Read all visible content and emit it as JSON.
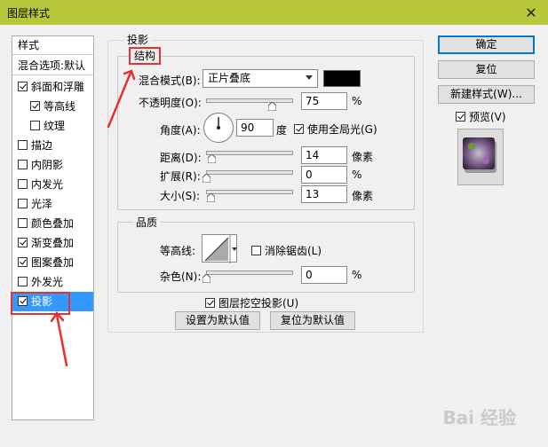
{
  "window": {
    "title": "图层样式",
    "close_glyph": "✕"
  },
  "style_list": {
    "header": "样式",
    "blend_options": "混合选项:默认",
    "items": [
      {
        "label": "斜面和浮雕",
        "checked": true,
        "indent": false
      },
      {
        "label": "等高线",
        "checked": true,
        "indent": true
      },
      {
        "label": "纹理",
        "checked": false,
        "indent": true
      },
      {
        "label": "描边",
        "checked": false,
        "indent": false
      },
      {
        "label": "内阴影",
        "checked": false,
        "indent": false
      },
      {
        "label": "内发光",
        "checked": false,
        "indent": false
      },
      {
        "label": "光泽",
        "checked": false,
        "indent": false
      },
      {
        "label": "颜色叠加",
        "checked": false,
        "indent": false
      },
      {
        "label": "渐变叠加",
        "checked": true,
        "indent": false
      },
      {
        "label": "图案叠加",
        "checked": true,
        "indent": false
      },
      {
        "label": "外发光",
        "checked": false,
        "indent": false
      },
      {
        "label": "投影",
        "checked": true,
        "indent": false,
        "selected": true
      }
    ]
  },
  "panel": {
    "title": "投影",
    "structure": {
      "title": "结构",
      "blend_mode_label": "混合模式(B):",
      "blend_mode_value": "正片叠底",
      "opacity_label": "不透明度(O):",
      "opacity_value": "75",
      "opacity_unit": "%",
      "opacity_fraction": 0.75,
      "angle_label": "角度(A):",
      "angle_value": "90",
      "angle_unit": "度",
      "global_light_label": "使用全局光(G)",
      "global_light_checked": true,
      "distance_label": "距离(D):",
      "distance_value": "14",
      "distance_unit": "像素",
      "distance_fraction": 0.06,
      "spread_label": "扩展(R):",
      "spread_value": "0",
      "spread_unit": "%",
      "spread_fraction": 0.0,
      "size_label": "大小(S):",
      "size_value": "13",
      "size_unit": "像素",
      "size_fraction": 0.05
    },
    "quality": {
      "title": "品质",
      "contour_label": "等高线:",
      "antialias_label": "消除锯齿(L)",
      "antialias_checked": false,
      "noise_label": "杂色(N):",
      "noise_value": "0",
      "noise_unit": "%",
      "noise_fraction": 0.0
    },
    "knockout_label": "图层挖空投影(U)",
    "knockout_checked": true,
    "make_default": "设置为默认值",
    "reset_default": "复位为默认值"
  },
  "buttons": {
    "ok": "确定",
    "reset": "复位",
    "new_style": "新建样式(W)...",
    "preview_label": "预览(V)",
    "preview_checked": true
  },
  "annotation_color": "#e8312f",
  "watermark": "Bai 经验"
}
